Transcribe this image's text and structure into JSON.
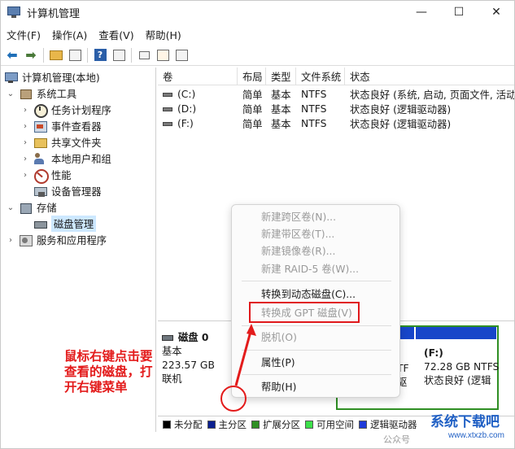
{
  "window": {
    "title": "计算机管理",
    "controls": {
      "minimize": "—",
      "maximize": "☐",
      "close": "✕"
    }
  },
  "menubar": [
    "文件(F)",
    "操作(A)",
    "查看(V)",
    "帮助(H)"
  ],
  "toolbar": {
    "icons": [
      "back-arrow-icon",
      "forward-arrow-icon",
      "up-folder-icon",
      "show-tree-icon",
      "help-icon",
      "properties-icon",
      "connect-icon",
      "check-icon",
      "list-view-icon"
    ],
    "help_glyph": "?"
  },
  "tree": {
    "root": "计算机管理(本地)",
    "system_tools": "系统工具",
    "task_scheduler": "任务计划程序",
    "event_viewer": "事件查看器",
    "shared_folders": "共享文件夹",
    "local_users": "本地用户和组",
    "performance": "性能",
    "device_manager": "设备管理器",
    "storage": "存储",
    "disk_management": "磁盘管理",
    "services_apps": "服务和应用程序",
    "chev_open": "⌄",
    "chev_closed": "›"
  },
  "volumes": {
    "columns": [
      "卷",
      "布局",
      "类型",
      "文件系统",
      "状态"
    ],
    "rows": [
      {
        "name": "(C:)",
        "layout": "简单",
        "type": "基本",
        "fs": "NTFS",
        "status": "状态良好 (系统, 启动, 页面文件, 活动,"
      },
      {
        "name": "(D:)",
        "layout": "简单",
        "type": "基本",
        "fs": "NTFS",
        "status": "状态良好 (逻辑驱动器)"
      },
      {
        "name": "(F:)",
        "layout": "简单",
        "type": "基本",
        "fs": "NTFS",
        "status": "状态良好 (逻辑驱动器)"
      }
    ]
  },
  "disk": {
    "name": "磁盘 0",
    "kind": "基本",
    "size": "223.57 GB",
    "state": "联机",
    "partition_fragment_1": "TF",
    "partition_fragment_2": "驱",
    "partition_F": {
      "label": "(F:)",
      "size": "72.28 GB NTFS",
      "status": "状态良好 (逻辑"
    }
  },
  "legend": [
    {
      "label": "未分配",
      "color": "#000000"
    },
    {
      "label": "主分区",
      "color": "#0a1f8f"
    },
    {
      "label": "扩展分区",
      "color": "#2f8f24"
    },
    {
      "label": "可用空间",
      "color": "#3de04b"
    },
    {
      "label": "逻辑驱动器",
      "color": "#1f3bd9"
    }
  ],
  "context_menu": {
    "items": [
      {
        "label": "新建跨区卷(N)...",
        "enabled": false
      },
      {
        "label": "新建带区卷(T)...",
        "enabled": false
      },
      {
        "label": "新建镜像卷(R)...",
        "enabled": false
      },
      {
        "label": "新建 RAID-5 卷(W)...",
        "enabled": false
      },
      {
        "label": "转换到动态磁盘(C)...",
        "enabled": true
      },
      {
        "label": "转换成 GPT 磁盘(V)",
        "enabled": false
      },
      {
        "label": "脱机(O)",
        "enabled": false
      },
      {
        "label": "属性(P)",
        "enabled": true
      },
      {
        "label": "帮助(H)",
        "enabled": true
      }
    ]
  },
  "annotation": {
    "text": "鼠标右键点击要查看的磁盘，打开右键菜单",
    "color": "#e31b1b"
  },
  "watermark": {
    "main": "系统下载吧",
    "sub": "www.xtxzb.com",
    "logo": "公众号"
  },
  "colors": {
    "accent_blue": "#1746c9",
    "extended_green": "#2f8f24",
    "highlight_red": "#e0191c",
    "selection": "#cde8ff"
  }
}
